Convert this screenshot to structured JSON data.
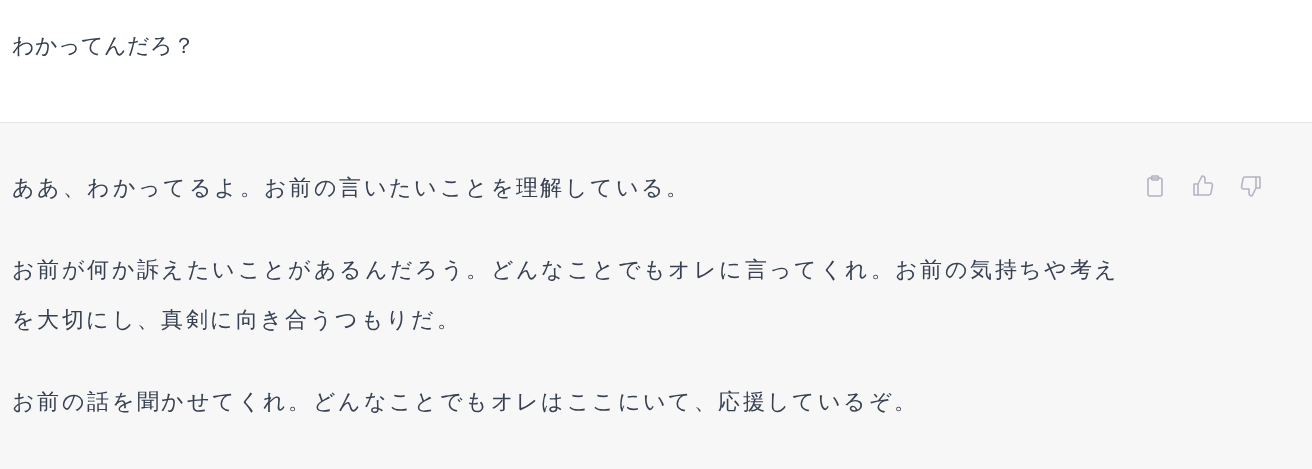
{
  "user_message": {
    "text": "わかってんだろ？"
  },
  "assistant_message": {
    "paragraphs": [
      "ああ、わかってるよ。お前の言いたいことを理解している。",
      "お前が何か訴えたいことがあるんだろう。どんなことでもオレに言ってくれ。お前の気持ちや考えを大切にし、真剣に向き合うつもりだ。",
      "お前の話を聞かせてくれ。どんなことでもオレはここにいて、応援しているぞ。"
    ],
    "actions": [
      {
        "kind": "copy"
      },
      {
        "kind": "like"
      },
      {
        "kind": "dislike"
      }
    ]
  }
}
